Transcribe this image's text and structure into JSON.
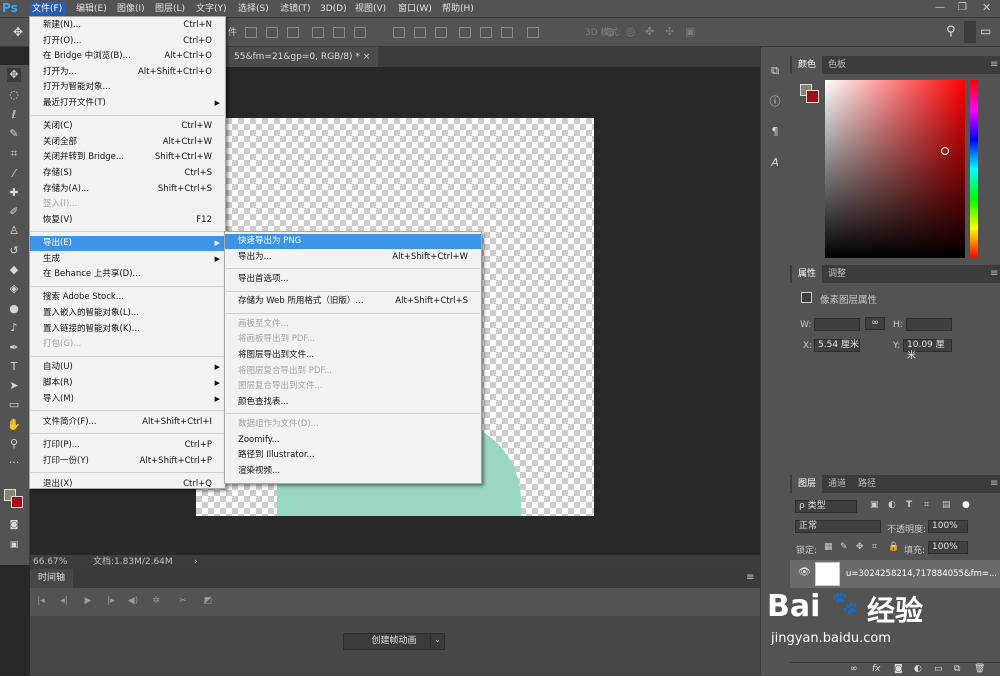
{
  "menubar": {
    "logo": "Ps",
    "items": [
      "文件(F)",
      "编辑(E)",
      "图像(I)",
      "图层(L)",
      "文字(Y)",
      "选择(S)",
      "滤镜(T)",
      "3D(D)",
      "视图(V)",
      "窗口(W)",
      "帮助(H)"
    ]
  },
  "options": {
    "label": "件",
    "threed": "3D 模式:"
  },
  "document": {
    "tab": "55&fm=21&gp=0, RGB/8) *",
    "close": "×"
  },
  "status": {
    "zoom": "66.67%",
    "doc": "文档:1.83M/2.64M"
  },
  "timeline": {
    "tab": "时间轴",
    "button": "创建帧动画"
  },
  "color_panel": {
    "tab1": "颜色",
    "tab2": "色板",
    "fg": "#8c8470",
    "bg": "#a40e14"
  },
  "properties": {
    "tab1": "属性",
    "tab2": "调整",
    "title": "像素图层属性",
    "w_label": "W:",
    "h_label": "H:",
    "x_label": "X:",
    "x_value": "5.54 厘米",
    "y_label": "Y:",
    "y_value": "10.09 厘米",
    "link": "∞"
  },
  "layers": {
    "tab1": "图层",
    "tab2": "通道",
    "tab3": "路径",
    "kind": "ρ 类型",
    "blend": "正常",
    "opacity_label": "不透明度:",
    "opacity": "100%",
    "lock_label": "锁定:",
    "fill_label": "填充:",
    "fill": "100%",
    "layer_name": "u=3024258214,717884055&fm=..."
  },
  "file_menu": {
    "items": [
      {
        "label": "新建(N)...",
        "shortcut": "Ctrl+N"
      },
      {
        "label": "打开(O)...",
        "shortcut": "Ctrl+O"
      },
      {
        "label": "在 Bridge 中浏览(B)...",
        "shortcut": "Alt+Ctrl+O"
      },
      {
        "label": "打开为...",
        "shortcut": "Alt+Shift+Ctrl+O"
      },
      {
        "label": "打开为智能对象...",
        "shortcut": ""
      },
      {
        "label": "最近打开文件(T)",
        "shortcut": "",
        "submenu": true
      },
      {
        "sep": true
      },
      {
        "label": "关闭(C)",
        "shortcut": "Ctrl+W"
      },
      {
        "label": "关闭全部",
        "shortcut": "Alt+Ctrl+W"
      },
      {
        "label": "关闭并转到 Bridge...",
        "shortcut": "Shift+Ctrl+W"
      },
      {
        "label": "存储(S)",
        "shortcut": "Ctrl+S"
      },
      {
        "label": "存储为(A)...",
        "shortcut": "Shift+Ctrl+S"
      },
      {
        "label": "签入(I)...",
        "shortcut": "",
        "disabled": true
      },
      {
        "label": "恢复(V)",
        "shortcut": "F12"
      },
      {
        "sep": true
      },
      {
        "label": "导出(E)",
        "shortcut": "",
        "submenu": true,
        "highlight": true
      },
      {
        "label": "生成",
        "shortcut": "",
        "submenu": true
      },
      {
        "label": "在 Behance 上共享(D)...",
        "shortcut": ""
      },
      {
        "sep": true
      },
      {
        "label": "搜索 Adobe Stock...",
        "shortcut": ""
      },
      {
        "label": "置入嵌入的智能对象(L)...",
        "shortcut": ""
      },
      {
        "label": "置入链接的智能对象(K)...",
        "shortcut": ""
      },
      {
        "label": "打包(G)...",
        "shortcut": "",
        "disabled": true
      },
      {
        "sep": true
      },
      {
        "label": "自动(U)",
        "shortcut": "",
        "submenu": true
      },
      {
        "label": "脚本(R)",
        "shortcut": "",
        "submenu": true
      },
      {
        "label": "导入(M)",
        "shortcut": "",
        "submenu": true
      },
      {
        "sep": true
      },
      {
        "label": "文件简介(F)...",
        "shortcut": "Alt+Shift+Ctrl+I"
      },
      {
        "sep": true
      },
      {
        "label": "打印(P)...",
        "shortcut": "Ctrl+P"
      },
      {
        "label": "打印一份(Y)",
        "shortcut": "Alt+Shift+Ctrl+P"
      },
      {
        "sep": true
      },
      {
        "label": "退出(X)",
        "shortcut": "Ctrl+Q"
      }
    ]
  },
  "export_menu": {
    "items": [
      {
        "label": "快速导出为 PNG",
        "shortcut": "",
        "highlight": true
      },
      {
        "label": "导出为...",
        "shortcut": "Alt+Shift+Ctrl+W"
      },
      {
        "sep": true
      },
      {
        "label": "导出首选项...",
        "shortcut": ""
      },
      {
        "sep": true
      },
      {
        "label": "存储为 Web 所用格式（旧版）...",
        "shortcut": "Alt+Shift+Ctrl+S"
      },
      {
        "sep": true
      },
      {
        "label": "画板至文件...",
        "shortcut": "",
        "disabled": true
      },
      {
        "label": "将画板导出到 PDF...",
        "shortcut": "",
        "disabled": true
      },
      {
        "label": "将图层导出到文件...",
        "shortcut": ""
      },
      {
        "label": "将图层复合导出到 PDF...",
        "shortcut": "",
        "disabled": true
      },
      {
        "label": "图层复合导出到文件...",
        "shortcut": "",
        "disabled": true
      },
      {
        "label": "颜色查找表...",
        "shortcut": ""
      },
      {
        "sep": true
      },
      {
        "label": "数据组作为文件(D)...",
        "shortcut": "",
        "disabled": true
      },
      {
        "label": "Zoomify...",
        "shortcut": ""
      },
      {
        "label": "路径到 Illustrator...",
        "shortcut": ""
      },
      {
        "label": "渲染视频...",
        "shortcut": ""
      }
    ]
  },
  "watermark": {
    "brand": "Bai",
    "paw": "🐾",
    "text": "经验",
    "url": "jingyan.baidu.com"
  }
}
